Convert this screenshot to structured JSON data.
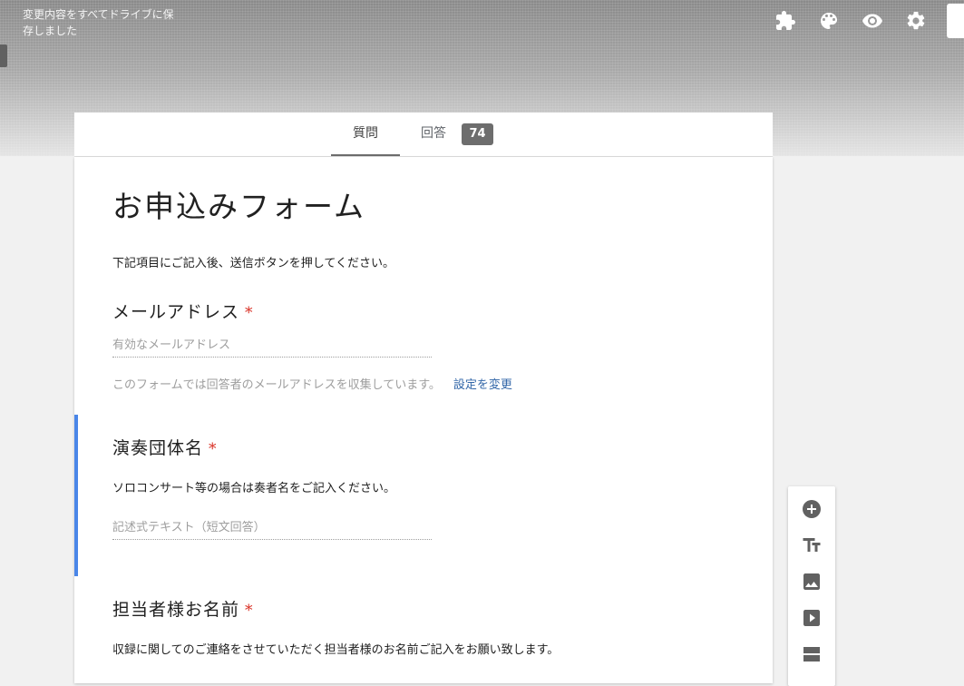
{
  "header": {
    "save_status": "変更内容をすべてドライブに保存しました",
    "icons": [
      "puzzle-icon",
      "palette-icon",
      "eye-icon",
      "gear-icon"
    ]
  },
  "tabs": {
    "questions": "質問",
    "responses": "回答",
    "responses_count": "74"
  },
  "form": {
    "title": "お申込みフォーム",
    "description": "下記項目にご記入後、送信ボタンを押してください。"
  },
  "questions": [
    {
      "title": "メールアドレス",
      "required_mark": "*",
      "placeholder": "有効なメールアドレス",
      "note": "このフォームでは回答者のメールアドレスを収集しています。",
      "link": "設定を変更"
    },
    {
      "title": "演奏団体名",
      "required_mark": "*",
      "description": "ソロコンサート等の場合は奏者名をご記入ください。",
      "placeholder": "記述式テキスト（短文回答）"
    },
    {
      "title": "担当者様お名前",
      "required_mark": "*",
      "description": "収録に関してのご連絡をさせていただく担当者様のお名前ご記入をお願い致します。"
    }
  ],
  "toolbar": {
    "icons": [
      "add-question-icon",
      "add-title-icon",
      "add-image-icon",
      "add-video-icon",
      "add-section-icon"
    ]
  },
  "colors": {
    "accent": "#4a86e8",
    "required": "#d93025",
    "link": "#3367a8",
    "badge": "#6d6d6d"
  }
}
